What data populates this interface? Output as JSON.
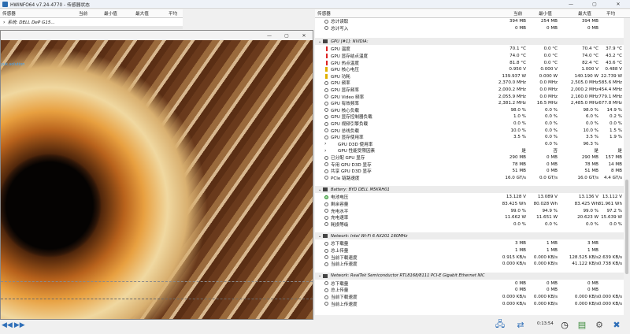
{
  "window": {
    "title": "HWiNFO64 v7.24-4770 - 传感器状态"
  },
  "window_controls": [
    "—",
    "▢",
    "✕"
  ],
  "left_header": {
    "sensor": "传感器",
    "current": "当前",
    "min": "最小值",
    "max": "最大值",
    "avg": "平均"
  },
  "right_header": {
    "sensor": "传感器",
    "current": "当前",
    "min": "最小值",
    "max": "最大值",
    "avg": "平均"
  },
  "left_tree": {
    "item": "系统: DELL DeP G15..."
  },
  "overlay": {
    "controls": [
      "—",
      "▢",
      "✕"
    ],
    "label": "yuk.solution"
  },
  "rows_top": [
    {
      "label": "总计读取",
      "c1": "394 MB",
      "c2": "254 MB",
      "c3": "394 MB",
      "c4": ""
    },
    {
      "label": "总计写入",
      "c1": "0 MB",
      "c2": "0 MB",
      "c3": "0 MB",
      "c4": ""
    }
  ],
  "gpu_group": {
    "label": "GPU [#1]: NVIDIA:"
  },
  "gpu_rows": [
    {
      "label": "GPU 温度",
      "icon": "temp",
      "c1": "70.1 °C",
      "c2": "0.0 °C",
      "c3": "70.4 °C",
      "c4": "37.9 °C"
    },
    {
      "label": "GPU 显存结点温度",
      "icon": "temp",
      "c1": "74.0 °C",
      "c2": "0.0 °C",
      "c3": "74.0 °C",
      "c4": "43.2 °C"
    },
    {
      "label": "GPU 热点温度",
      "icon": "temp",
      "c1": "81.8 °C",
      "c2": "0.0 °C",
      "c3": "82.4 °C",
      "c4": "43.6 °C"
    },
    {
      "label": "GPU 核心电压",
      "icon": "volt",
      "c1": "0.950 V",
      "c2": "0.000 V",
      "c3": "1.000 V",
      "c4": "0.488 V"
    },
    {
      "label": "GPU 功耗",
      "icon": "volt",
      "c1": "139.937 W",
      "c2": "0.000 W",
      "c3": "140.190 W",
      "c4": "22.739 W"
    },
    {
      "label": "GPU 频率",
      "icon": "circle",
      "c1": "2,370.0 MHz",
      "c2": "0.0 MHz",
      "c3": "2,505.0 MHz",
      "c4": "585.6 MHz"
    },
    {
      "label": "GPU 显存频率",
      "icon": "circle",
      "c1": "2,000.2 MHz",
      "c2": "0.0 MHz",
      "c3": "2,000.2 MHz",
      "c4": "454.4 MHz"
    },
    {
      "label": "GPU Video 频率",
      "icon": "circle",
      "c1": "2,055.9 MHz",
      "c2": "0.0 MHz",
      "c3": "2,160.0 MHz",
      "c4": "779.1 MHz"
    },
    {
      "label": "GPU 有效频率",
      "icon": "circle",
      "c1": "2,381.2 MHz",
      "c2": "16.5 MHz",
      "c3": "2,485.0 MHz",
      "c4": "677.8 MHz"
    },
    {
      "label": "GPU 核心负载",
      "icon": "circle",
      "c1": "98.0 %",
      "c2": "0.0 %",
      "c3": "98.0 %",
      "c4": "14.9 %"
    },
    {
      "label": "GPU 显存控制器负载",
      "icon": "circle",
      "c1": "1.0 %",
      "c2": "0.0 %",
      "c3": "6.0 %",
      "c4": "0.2 %"
    },
    {
      "label": "GPU 视频引擎负载",
      "icon": "circle",
      "c1": "0.0 %",
      "c2": "0.0 %",
      "c3": "0.0 %",
      "c4": "0.0 %"
    },
    {
      "label": "GPU 总线负载",
      "icon": "circle",
      "c1": "10.0 %",
      "c2": "0.0 %",
      "c3": "10.0 %",
      "c4": "1.5 %"
    },
    {
      "label": "GPU 显存使用率",
      "icon": "circle",
      "c1": "3.5 %",
      "c2": "0.0 %",
      "c3": "3.5 %",
      "c4": "1.9 %"
    },
    {
      "label": "GPU D3D 使用率",
      "icon": "chev",
      "c1": "",
      "c2": "0.0 %",
      "c3": "96.3 %",
      "c4": ""
    },
    {
      "label": "GPU 性能受限因素",
      "icon": "chev",
      "c1": "是",
      "c2": "否",
      "c3": "是",
      "c4": "是"
    },
    {
      "label": "已分配 GPU 显存",
      "icon": "circle",
      "c1": "290 MB",
      "c2": "0 MB",
      "c3": "290 MB",
      "c4": "157 MB"
    },
    {
      "label": "专用 GPU D3D 显存",
      "icon": "circle",
      "c1": "78 MB",
      "c2": "0 MB",
      "c3": "78 MB",
      "c4": "14 MB"
    },
    {
      "label": "共享 GPU D3D 显存",
      "icon": "circle",
      "c1": "51 MB",
      "c2": "0 MB",
      "c3": "51 MB",
      "c4": "8 MB"
    },
    {
      "label": "PCIe 链路速度",
      "icon": "circle",
      "c1": "16.0 GT/s",
      "c2": "0.0 GT/s",
      "c3": "16.0 GT/s",
      "c4": "4.4 GT/s"
    }
  ],
  "battery_group": {
    "label": "Battery: BYD DELL M5KRH01"
  },
  "battery_rows": [
    {
      "label": "电池电压",
      "icon": "grn",
      "c1": "13.128 V",
      "c2": "13.089 V",
      "c3": "13.136 V",
      "c4": "13.112 V"
    },
    {
      "label": "剩余容量",
      "icon": "circle",
      "c1": "83.425 Wh",
      "c2": "80.028 Wh",
      "c3": "83.425 Wh",
      "c4": "81.961 Wh"
    },
    {
      "label": "充电水平",
      "icon": "circle",
      "c1": "99.0 %",
      "c2": "94.9 %",
      "c3": "99.0 %",
      "c4": "97.2 %"
    },
    {
      "label": "充电速率",
      "icon": "circle",
      "c1": "11.662 W",
      "c2": "11.651 W",
      "c3": "20.623 W",
      "c4": "15.639 W"
    },
    {
      "label": "耗损等级",
      "icon": "circle",
      "c1": "0.0 %",
      "c2": "0.0 %",
      "c3": "0.0 %",
      "c4": "0.0 %"
    }
  ],
  "net1_group": {
    "label": "Network: Intel Wi-Fi 6 AX201 160MHz"
  },
  "net1_rows": [
    {
      "label": "总下载量",
      "icon": "circle",
      "c1": "3 MB",
      "c2": "1 MB",
      "c3": "3 MB",
      "c4": ""
    },
    {
      "label": "总上传量",
      "icon": "circle",
      "c1": "1 MB",
      "c2": "1 MB",
      "c3": "1 MB",
      "c4": ""
    },
    {
      "label": "当前下载速度",
      "icon": "circle",
      "c1": "0.915 KB/s",
      "c2": "0.000 KB/s",
      "c3": "128.525 KB/s",
      "c4": "2.639 KB/s"
    },
    {
      "label": "当前上传速度",
      "icon": "circle",
      "c1": "0.000 KB/s",
      "c2": "0.000 KB/s",
      "c3": "41.122 KB/s",
      "c4": "0.738 KB/s"
    }
  ],
  "net2_group": {
    "label": "Network: RealTek Semiconductor RTL8168/8111 PCI-E Gigabit Ethernet NIC"
  },
  "net2_rows": [
    {
      "label": "总下载量",
      "icon": "circle",
      "c1": "0 MB",
      "c2": "0 MB",
      "c3": "0 MB",
      "c4": ""
    },
    {
      "label": "总上传量",
      "icon": "circle",
      "c1": "0 MB",
      "c2": "0 MB",
      "c3": "0 MB",
      "c4": ""
    },
    {
      "label": "当前下载速度",
      "icon": "circle",
      "c1": "0.000 KB/s",
      "c2": "0.000 KB/s",
      "c3": "0.000 KB/s",
      "c4": "0.000 KB/s"
    },
    {
      "label": "当前上传速度",
      "icon": "circle",
      "c1": "0.000 KB/s",
      "c2": "0.000 KB/s",
      "c3": "0.000 KB/s",
      "c4": "0.000 KB/s"
    }
  ],
  "footer": {
    "timer": "0:13:54",
    "left_arrows": [
      "◀◀",
      "▶▶"
    ]
  },
  "taskbar_icons": [
    "network-icon",
    "network-share-icon",
    "clock-icon",
    "report-icon",
    "settings-icon",
    "close-icon"
  ],
  "colors": {
    "temp_icon": "#dd2222",
    "volt_icon": "#e0b000",
    "group_bg": "#ececec",
    "accent_blue": "#2f6fb8"
  }
}
